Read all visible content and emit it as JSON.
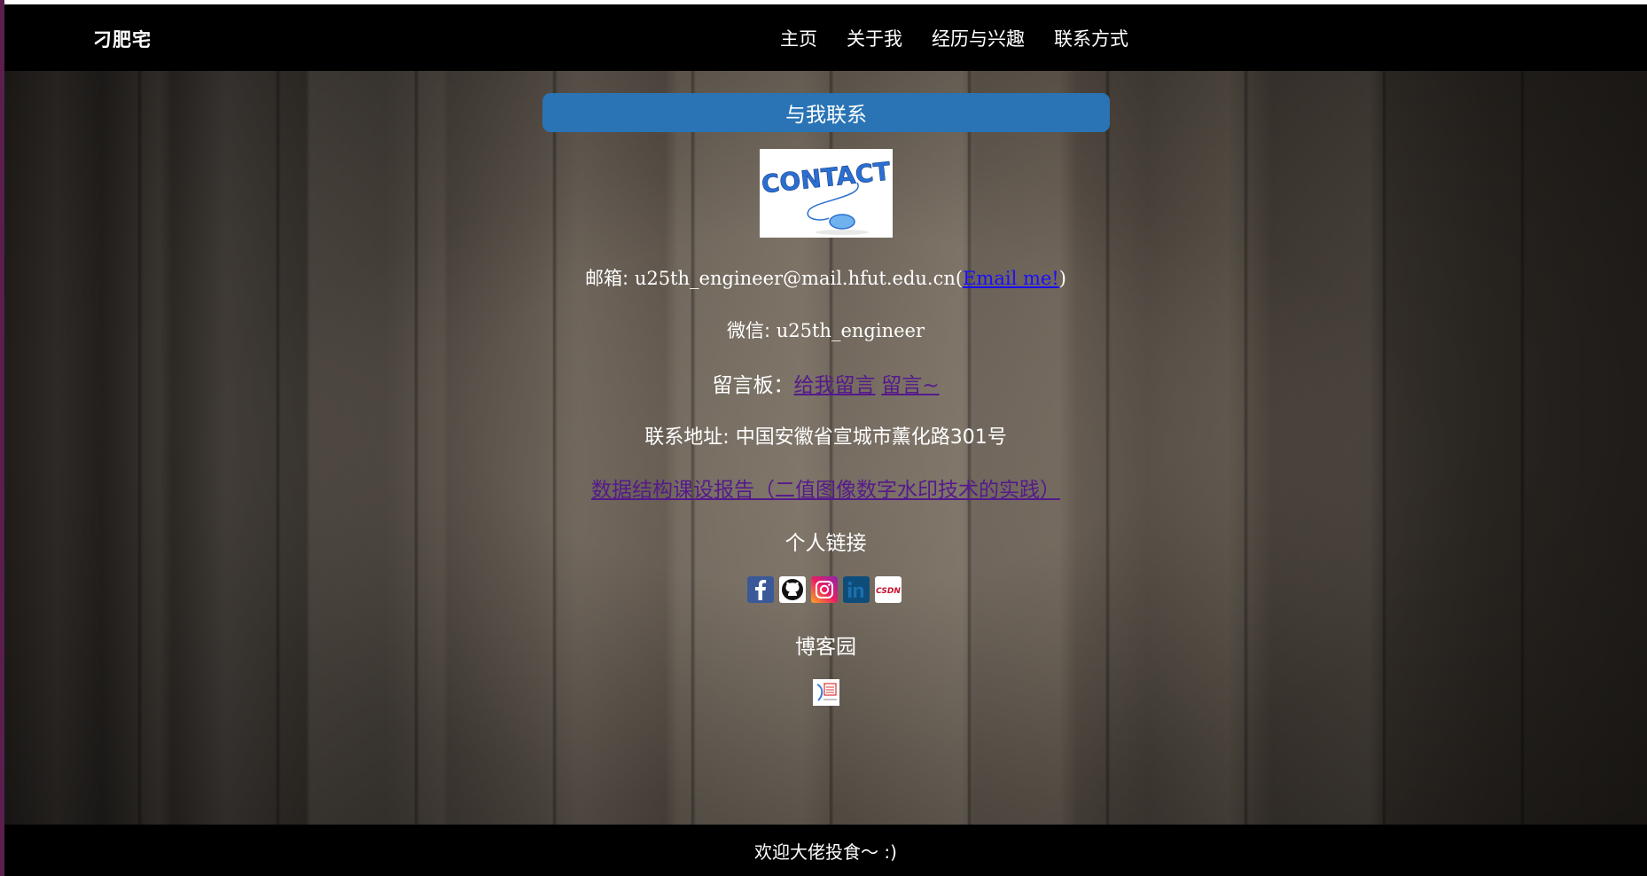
{
  "header": {
    "brand": "刁肥宅",
    "nav": [
      "主页",
      "关于我",
      "经历与兴趣",
      "联系方式"
    ]
  },
  "contact": {
    "title": "与我联系",
    "image_text": "CONTACT",
    "email_label": "邮箱: ",
    "email": "u25th_engineer@mail.hfut.edu.cn",
    "email_link": "Email me!",
    "wechat_label": "微信: ",
    "wechat": "u25th_engineer",
    "board_label": "留言板：",
    "board_link1": "给我留言",
    "board_link2": "留言~",
    "address_label": "联系地址: ",
    "address": "中国安徽省宣城市薰化路301号",
    "report_link": "数据结构课设报告（二值图像数字水印技术的实践）",
    "personal_links_title": "个人链接",
    "social_icons": [
      "facebook-icon",
      "github-icon",
      "instagram-icon",
      "linkedin-icon",
      "csdn-icon"
    ],
    "csdn_text": "CSDN",
    "blog_title": "博客园"
  },
  "footer": {
    "text": "欢迎大佬投食～ :)"
  },
  "colors": {
    "nav_bg": "#000000",
    "heading_bar": "#2a74b5",
    "link": "#1a0dff",
    "visited_link": "#551a8b"
  }
}
